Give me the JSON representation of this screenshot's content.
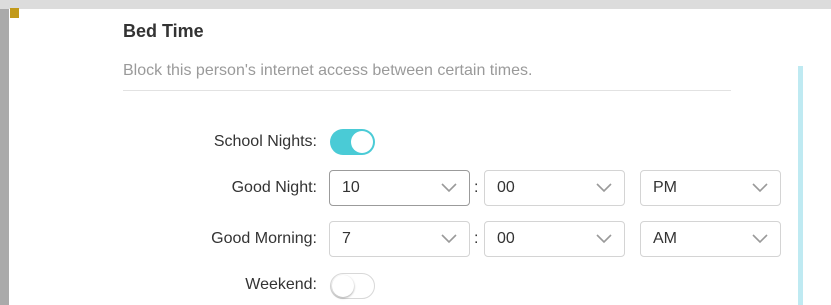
{
  "section": {
    "title": "Bed Time",
    "description": "Block this person's internet access between certain times."
  },
  "school_nights": {
    "label": "School Nights:",
    "enabled": true
  },
  "good_night": {
    "label": "Good Night:",
    "hour": "10",
    "minute": "00",
    "period": "PM"
  },
  "good_morning": {
    "label": "Good Morning:",
    "hour": "7",
    "minute": "00",
    "period": "AM"
  },
  "weekend": {
    "label": "Weekend:",
    "enabled": false
  },
  "separator": ":",
  "icons": {
    "dropdown": "chevron-down-icon"
  },
  "colors": {
    "toggle_on": "#4acbd6",
    "scrollbar": "#bfeaf2",
    "corner_accent": "#c29a1a",
    "description_text": "#9a9a9a"
  }
}
